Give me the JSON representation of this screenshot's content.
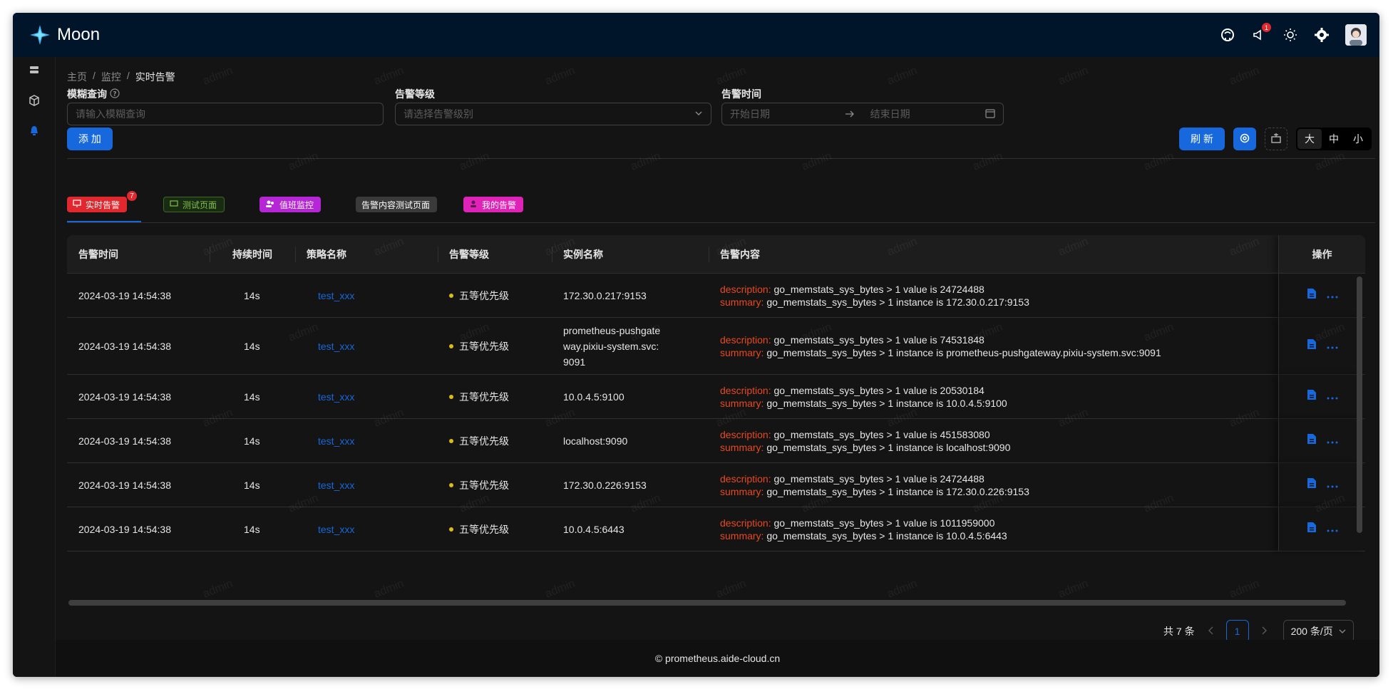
{
  "app": {
    "name": "Moon"
  },
  "header": {
    "notice_count": "1"
  },
  "breadcrumb": {
    "home": "主页",
    "monitor": "监控",
    "current": "实时告警",
    "sep": "/"
  },
  "filters": {
    "fuzzy_label": "模糊查询",
    "fuzzy_placeholder": "请输入模糊查询",
    "level_label": "告警等级",
    "level_placeholder": "请选择告警级别",
    "time_label": "告警时间",
    "start_placeholder": "开始日期",
    "end_placeholder": "结束日期"
  },
  "toolbar": {
    "add": "添 加",
    "refresh": "刷 新",
    "size_large": "大",
    "size_medium": "中",
    "size_small": "小"
  },
  "tabs": [
    {
      "label": "实时告警",
      "color": "#e0282e",
      "badge": "7"
    },
    {
      "label": "测试页面",
      "color": "#1a2b13"
    },
    {
      "label": "值班监控",
      "color": "#b625d6"
    },
    {
      "label": "告警内容测试页面",
      "color": "#3a3a3a"
    },
    {
      "label": "我的告警",
      "color": "#e023b8"
    }
  ],
  "table": {
    "columns": [
      "告警时间",
      "持续时间",
      "策略名称",
      "告警等级",
      "实例名称",
      "告警内容",
      "操作"
    ],
    "desc_key": "description:",
    "summary_key": "summary:",
    "rows": [
      {
        "time": "2024-03-19 14:54:38",
        "duration": "14s",
        "strategy": "test_xxx",
        "level": "五等优先级",
        "instance": "172.30.0.217:9153",
        "desc": "go_memstats_sys_bytes > 1 value is 24724488",
        "summary": "go_memstats_sys_bytes > 1 instance is 172.30.0.217:9153"
      },
      {
        "time": "2024-03-19 14:54:38",
        "duration": "14s",
        "strategy": "test_xxx",
        "level": "五等优先级",
        "instance": "prometheus-pushgateway.pixiu-system.svc:9091",
        "desc": "go_memstats_sys_bytes > 1 value is 74531848",
        "summary": "go_memstats_sys_bytes > 1 instance is prometheus-pushgateway.pixiu-system.svc:9091"
      },
      {
        "time": "2024-03-19 14:54:38",
        "duration": "14s",
        "strategy": "test_xxx",
        "level": "五等优先级",
        "instance": "10.0.4.5:9100",
        "desc": "go_memstats_sys_bytes > 1 value is 20530184",
        "summary": "go_memstats_sys_bytes > 1 instance is 10.0.4.5:9100"
      },
      {
        "time": "2024-03-19 14:54:38",
        "duration": "14s",
        "strategy": "test_xxx",
        "level": "五等优先级",
        "instance": "localhost:9090",
        "desc": "go_memstats_sys_bytes > 1 value is 451583080",
        "summary": "go_memstats_sys_bytes > 1 instance is localhost:9090"
      },
      {
        "time": "2024-03-19 14:54:38",
        "duration": "14s",
        "strategy": "test_xxx",
        "level": "五等优先级",
        "instance": "172.30.0.226:9153",
        "desc": "go_memstats_sys_bytes > 1 value is 24724488",
        "summary": "go_memstats_sys_bytes > 1 instance is 172.30.0.226:9153"
      },
      {
        "time": "2024-03-19 14:54:38",
        "duration": "14s",
        "strategy": "test_xxx",
        "level": "五等优先级",
        "instance": "10.0.4.5:6443",
        "desc": "go_memstats_sys_bytes > 1 value is 1011959000",
        "summary": "go_memstats_sys_bytes > 1 instance is 10.0.4.5:6443"
      }
    ]
  },
  "pagination": {
    "total": "共 7 条",
    "page": "1",
    "page_size": "200 条/页"
  },
  "footer": {
    "text": "© prometheus.aide-cloud.cn"
  },
  "watermark": "admin",
  "colors": {
    "header_bg": "#001529",
    "primary": "#1668dc",
    "danger": "#e0282e",
    "level_dot": "#d8bd14",
    "desc_key": "#e8481f"
  }
}
